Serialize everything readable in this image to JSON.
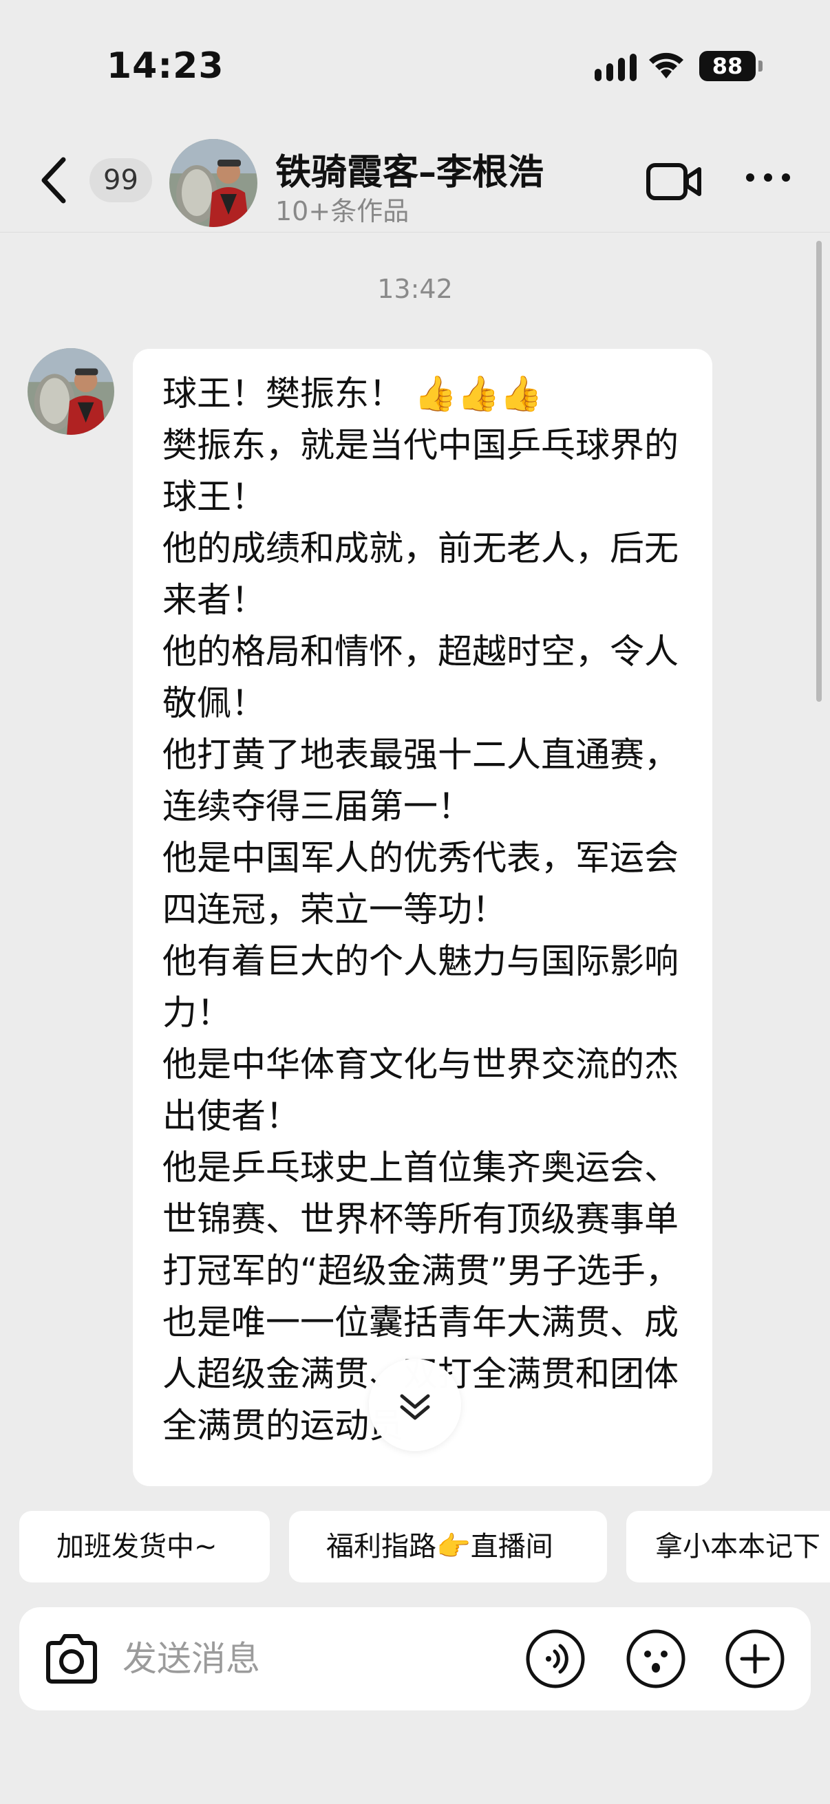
{
  "status_bar": {
    "time": "14:23",
    "battery": "88"
  },
  "header": {
    "unread_count": "99",
    "contact_name": "铁骑霞客–李根浩",
    "subtitle": "10+条作品"
  },
  "chat": {
    "timestamp": "13:42",
    "message": {
      "first_line": "球王！樊振东！",
      "first_line_emoji": "👍👍👍",
      "body": "樊振东，就是当代中国乒乓球界的球王！\n他的成绩和成就，前无老人，后无来者！\n他的格局和情怀，超越时空，令人敬佩！\n他打黄了地表最强十二人直通赛，连续夺得三届第一！\n他是中国军人的优秀代表，军运会四连冠，荣立一等功！\n他有着巨大的个人魅力与国际影响力！\n他是中华体育文化与世界交流的杰出使者！\n他是乒乓球史上首位集齐奥运会、世锦赛、世界杯等所有顶级赛事单打冠军的“超级金满贯”男子选手，也是唯一一位囊括青年大满贯、成人超级金满贯、双打全满贯和团体全满贯的运动员"
    }
  },
  "quick_replies": [
    {
      "label": "加班发货中~"
    },
    {
      "label": "福利指路👉直播间"
    },
    {
      "label": "拿小本本记下"
    }
  ],
  "input": {
    "placeholder": "发送消息"
  },
  "icons": {
    "back": "chevron-left-icon",
    "video": "video-call-icon",
    "more": "more-dots-icon",
    "camera": "camera-icon",
    "voice": "voice-icon",
    "emoji": "emoji-icon",
    "plus": "plus-icon",
    "scroll_down": "double-chevron-down-icon"
  }
}
